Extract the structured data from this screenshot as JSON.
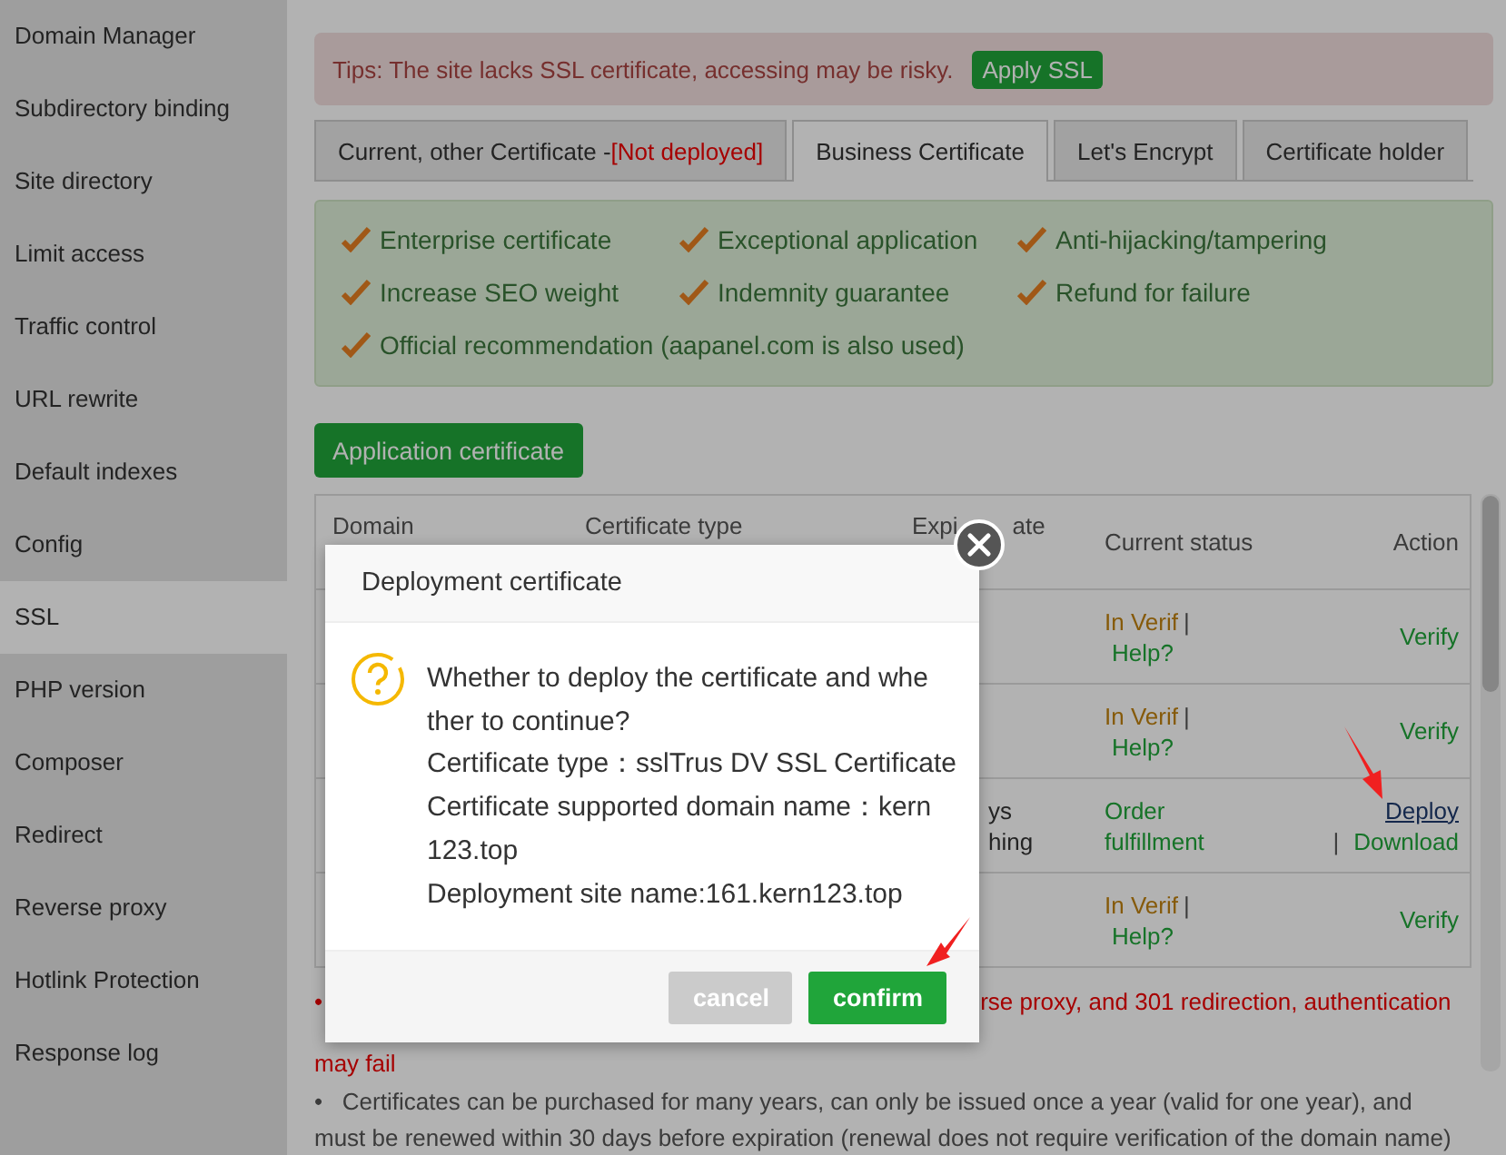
{
  "sidebar": {
    "items": [
      {
        "label": "Domain Manager",
        "selected": false
      },
      {
        "label": "Subdirectory binding",
        "selected": false
      },
      {
        "label": "Site directory",
        "selected": false
      },
      {
        "label": "Limit access",
        "selected": false
      },
      {
        "label": "Traffic control",
        "selected": false
      },
      {
        "label": "URL rewrite",
        "selected": false
      },
      {
        "label": "Default indexes",
        "selected": false
      },
      {
        "label": "Config",
        "selected": false
      },
      {
        "label": "SSL",
        "selected": true
      },
      {
        "label": "PHP version",
        "selected": false
      },
      {
        "label": "Composer",
        "selected": false
      },
      {
        "label": "Redirect",
        "selected": false
      },
      {
        "label": "Reverse proxy",
        "selected": false
      },
      {
        "label": "Hotlink Protection",
        "selected": false
      },
      {
        "label": "Response log",
        "selected": false
      }
    ]
  },
  "tips": {
    "text": "Tips: The site lacks SSL certificate, accessing may be risky.",
    "button": "Apply SSL"
  },
  "tabs": [
    {
      "label": "Current, other Certificate - ",
      "badge": "[Not deployed]",
      "selected": false
    },
    {
      "label": "Business Certificate",
      "selected": true
    },
    {
      "label": "Let's Encrypt",
      "selected": false
    },
    {
      "label": "Certificate holder",
      "selected": false
    }
  ],
  "features": [
    "Enterprise certificate",
    "Exceptional application",
    "Anti-hijacking/tampering",
    "Increase SEO weight",
    "Indemnity guarantee",
    "Refund for failure",
    "Official recommendation (aapanel.com is also used)"
  ],
  "apply_button": "Application certificate",
  "table": {
    "columns": [
      {
        "label": "Domain"
      },
      {
        "label": "Certificate type"
      },
      {
        "label": "Expi",
        "label_tail": "ate"
      },
      {
        "label": "Current status"
      },
      {
        "label": "Action"
      }
    ],
    "rows": [
      {
        "expiry": [],
        "status": {
          "kind": "verifying",
          "label": "In Verif",
          "separator": "|",
          "help": "Help?"
        },
        "actions": [
          {
            "label": "Verify",
            "hovered": false
          }
        ]
      },
      {
        "expiry": [],
        "status": {
          "kind": "verifying",
          "label": "In Verif",
          "separator": "|",
          "help": "Help?"
        },
        "actions": [
          {
            "label": "Verify",
            "hovered": false
          }
        ]
      },
      {
        "expiry": [
          "ys",
          "hing"
        ],
        "status": {
          "kind": "complete",
          "label": "Order fulfillment"
        },
        "actions": [
          {
            "label": "Deploy",
            "hovered": true
          },
          {
            "separator": "|",
            "label": "Download",
            "hovered": false
          }
        ]
      },
      {
        "expiry": [],
        "status": {
          "kind": "verifying",
          "label": "In Verif",
          "separator": "|",
          "help": "Help?"
        },
        "actions": [
          {
            "label": "Verify",
            "hovered": false
          }
        ]
      }
    ]
  },
  "notes": [
    {
      "kind": "warning",
      "bullet": "•",
      "text": "rse proxy, and 301 redirection, authentication",
      "continuation": "may fail"
    },
    {
      "kind": "info",
      "bullet": "•",
      "text": "Certificates can be purchased for many years, can only be issued once a year (valid for one year), and must be renewed within 30 days before expiration (renewal does not require verification of the domain name)"
    }
  ],
  "dialog": {
    "title": "Deployment certificate",
    "lines": [
      "Whether to deploy the certificate and whe",
      "ther to continue?",
      "Certificate type：sslTrus DV SSL Certificate",
      "Certificate supported domain name：kern",
      "123.top",
      "Deployment site name:161.kern123.top"
    ],
    "buttons": [
      {
        "label": "cancel",
        "kind": "secondary"
      },
      {
        "label": "confirm",
        "kind": "primary"
      }
    ]
  }
}
